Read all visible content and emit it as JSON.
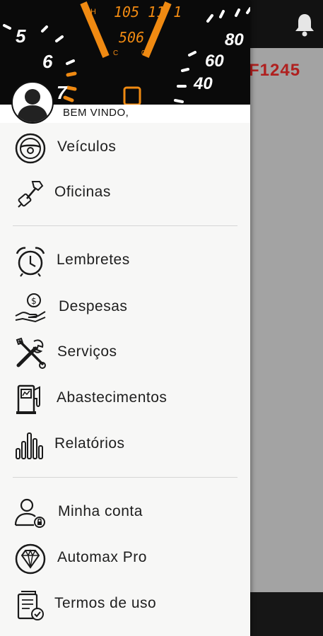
{
  "background": {
    "plate_text": "F1245",
    "bell_icon": "bell-icon",
    "dashboard": {
      "odometer": "105 11 1",
      "trip": "506",
      "rpm_numbers": [
        "5",
        "6",
        "7"
      ],
      "speed_numbers": [
        "80",
        "60",
        "40"
      ]
    }
  },
  "drawer": {
    "welcome": "BEM VINDO,",
    "sections": [
      [
        {
          "label": "Veículos",
          "icon": "steering-wheel-icon"
        },
        {
          "label": "Oficinas",
          "icon": "wrench-plug-icon"
        }
      ],
      [
        {
          "label": "Lembretes",
          "icon": "alarm-clock-icon"
        },
        {
          "label": "Despesas",
          "icon": "money-hand-icon"
        },
        {
          "label": "Serviços",
          "icon": "tools-icon"
        },
        {
          "label": "Abastecimentos",
          "icon": "fuel-pump-icon"
        },
        {
          "label": "Relatórios",
          "icon": "bar-chart-icon"
        }
      ],
      [
        {
          "label": "Minha conta",
          "icon": "user-account-icon"
        },
        {
          "label": "Automax Pro",
          "icon": "diamond-icon"
        },
        {
          "label": "Termos de uso",
          "icon": "document-check-icon"
        }
      ]
    ]
  },
  "colors": {
    "drawer_bg": "#f7f7f6",
    "plate_red": "#b0201f",
    "gauge_orange": "#f08a12"
  }
}
